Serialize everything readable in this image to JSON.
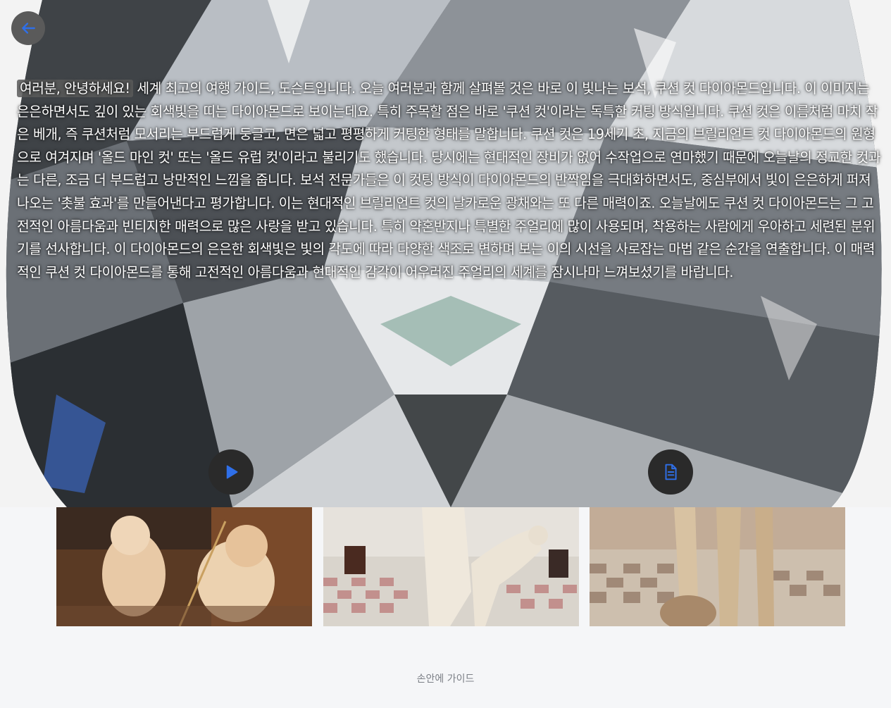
{
  "hero": {
    "image_label": "cushion-cut-diamond-image",
    "narration_first": "여러분, 안녕하세요!",
    "narration_rest": " 세계 최고의 여행 가이드, 도슨트입니다. 오늘 여러분과 함께 살펴볼 것은 바로 이 빛나는 보석, 쿠션 컷 다이아몬드입니다. 이 이미지는 은은하면서도 깊이 있는 회색빛을 띠는 다이아몬드로 보이는데요. 특히 주목할 점은 바로 '쿠션 컷'이라는 독특한 커팅 방식입니다. 쿠션 컷은 이름처럼 마치 작은 베개, 즉 쿠션처럼 모서리는 부드럽게 둥글고, 면은 넓고 평평하게 커팅한 형태를 말합니다. 쿠션 컷은 19세기 초, 지금의 브릴리언트 컷 다이아몬드의 원형으로 여겨지며 '올드 마인 컷' 또는 '올드 유럽 컷'이라고 불리기도 했습니다. 당시에는 현대적인 장비가 없어 수작업으로 연마했기 때문에 오늘날의 정교한 컷과는 다른, 조금 더 부드럽고 낭만적인 느낌을 줍니다. 보석 전문가들은 이 컷팅 방식이 다이아몬드의 반짝임을 극대화하면서도, 중심부에서 빛이 은은하게 퍼져 나오는 '촛불 효과'를 만들어낸다고 평가합니다. 이는 현대적인 브릴리언트 컷의 날카로운 광채와는 또 다른 매력이죠. 오늘날에도 쿠션 컷 다이아몬드는 그 고전적인 아름다움과 빈티지한 매력으로 많은 사랑을 받고 있습니다. 특히 약혼반지나 특별한 주얼리에 많이 사용되며, 착용하는 사람에게 우아하고 세련된 분위기를 선사합니다. 이 다이아몬드의 은은한 회색빛은 빛의 각도에 따라 다양한 색조로 변하며 보는 이의 시선을 사로잡는 마법 같은 순간을 연출합니다. 이 매력적인 쿠션 컷 다이아몬드를 통해 고전적인 아름다움과 현대적인 감각이 어우러진 주얼리의 세계를 잠시나마 느껴보셨기를 바랍니다."
  },
  "icons": {
    "back": "arrow-left-icon",
    "play": "play-icon",
    "document": "document-icon"
  },
  "colors": {
    "accent": "#2f6fe8",
    "button_dark": "#2a2a2a",
    "back_button": "#5a5a5a",
    "background": "#f5f6f8",
    "footer_text": "#7b7f86"
  },
  "thumbnails": [
    {
      "subject": "painting-two-infants"
    },
    {
      "subject": "marble-statue-with-deer"
    },
    {
      "subject": "marble-statue-legs"
    }
  ],
  "footer": {
    "text": "손안에 가이드"
  }
}
